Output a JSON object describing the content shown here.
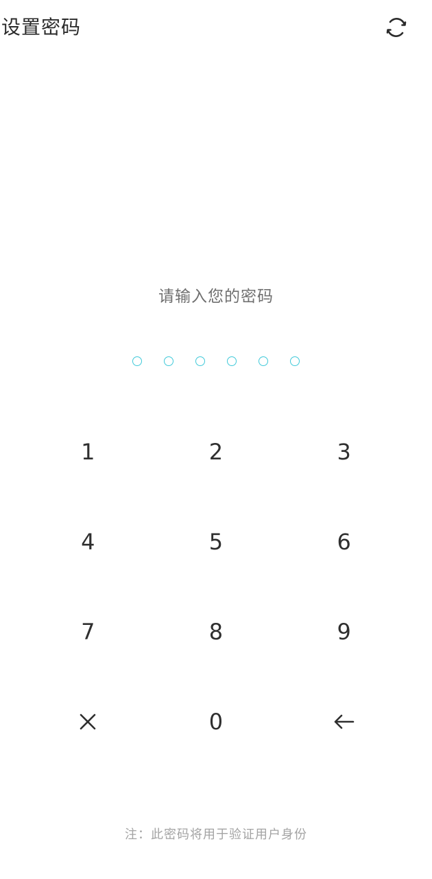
{
  "header": {
    "title": "设置密码",
    "refresh_icon": "refresh-icon"
  },
  "prompt": "请输入您的密码",
  "pin": {
    "length": 6,
    "filled": 0,
    "dot_color": "#3fc9d9"
  },
  "keypad": {
    "keys": [
      {
        "label": "1",
        "type": "digit"
      },
      {
        "label": "2",
        "type": "digit"
      },
      {
        "label": "3",
        "type": "digit"
      },
      {
        "label": "4",
        "type": "digit"
      },
      {
        "label": "5",
        "type": "digit"
      },
      {
        "label": "6",
        "type": "digit"
      },
      {
        "label": "7",
        "type": "digit"
      },
      {
        "label": "8",
        "type": "digit"
      },
      {
        "label": "9",
        "type": "digit"
      },
      {
        "label": "",
        "type": "close",
        "icon": "close-icon"
      },
      {
        "label": "0",
        "type": "digit"
      },
      {
        "label": "",
        "type": "backspace",
        "icon": "backspace-arrow-icon"
      }
    ]
  },
  "note": "注：此密码将用于验证用户身份"
}
